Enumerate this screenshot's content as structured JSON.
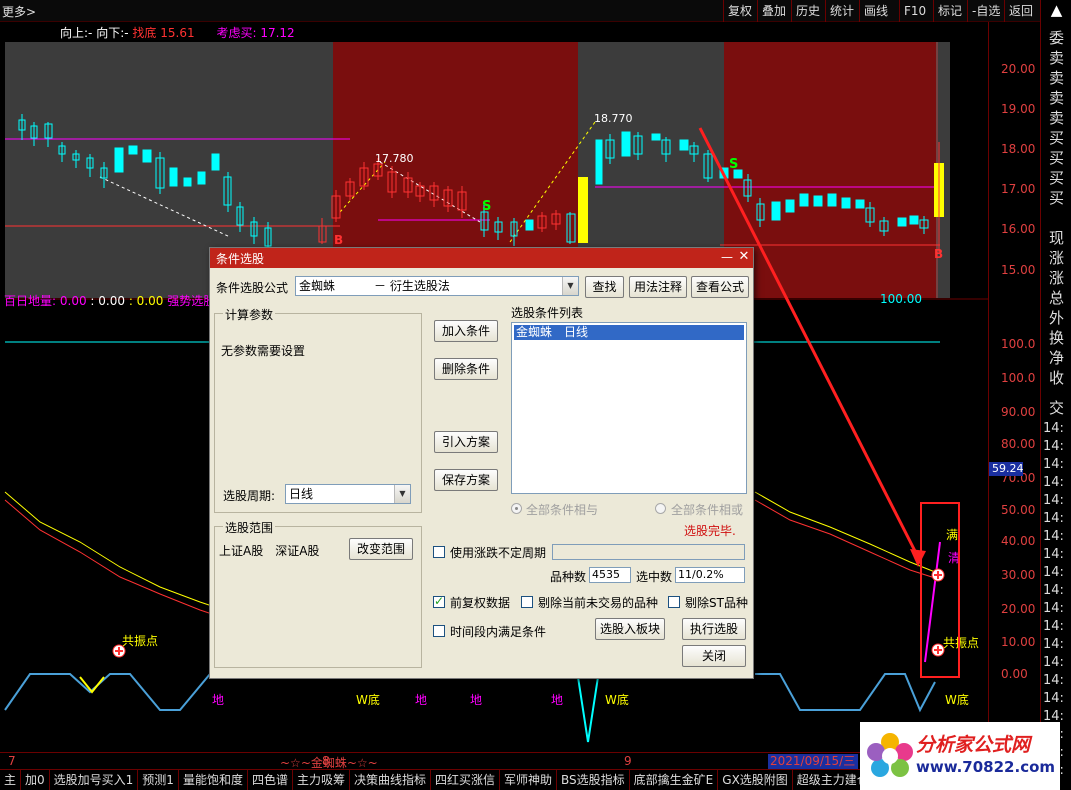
{
  "toolbar": {
    "more": "更多>",
    "buttons": [
      "复权",
      "叠加",
      "历史",
      "统计",
      "画线",
      "F10",
      "标记",
      "-自选",
      "返回"
    ]
  },
  "legend": {
    "up": "向上:-",
    "down": "向下:-",
    "bottom_label": "找底",
    "bottom_value": "15.61",
    "buy_label": "考虑买:",
    "buy_value": "17.12"
  },
  "indicator_legend": {
    "name": "百日地量:",
    "v1": "0.00",
    "v2": ": 0.00",
    "v3": ": 0.00",
    "strong": "强势选股",
    "right_value": "100.00"
  },
  "annotations": {
    "peak1": "17.780",
    "peak2": "18.770",
    "signal_s": "S",
    "signal_b": "B",
    "resonance": "共振点",
    "w_bottom": "W底",
    "ground": "地",
    "full": "满",
    "clear": "清"
  },
  "price_axis": {
    "labels": [
      "20.00",
      "19.00",
      "18.00",
      "17.00",
      "16.00",
      "15.00"
    ],
    "indicator_labels": [
      "100.0",
      "100.0",
      "90.00",
      "80.00",
      "70.00",
      "60.00",
      "50.00",
      "40.00",
      "30.00",
      "20.00",
      "10.00",
      "0.00"
    ],
    "badge": "59.24"
  },
  "right_panel": {
    "items": [
      "委",
      "卖",
      "卖",
      "卖",
      "卖",
      "买",
      "买",
      "买",
      "买",
      "现",
      "涨",
      "涨",
      "总",
      "外",
      "换",
      "净",
      "收",
      "交"
    ],
    "times": [
      "14:",
      "14:",
      "14:",
      "14:",
      "14:",
      "14:",
      "14:",
      "14:",
      "14:",
      "14:",
      "14:",
      "14:",
      "14:",
      "14:",
      "14:",
      "14:",
      "14:",
      "14:",
      "14:",
      "14:"
    ]
  },
  "date_bar": {
    "m7": "7",
    "m8": "8",
    "m9": "9",
    "mantis": "~☆~金蜘蛛~☆~",
    "date": "2021/09/15/三"
  },
  "tabs": [
    "主",
    "加0",
    "选股加号买入1",
    "预测1",
    "量能饱和度",
    "四色谱",
    "主力吸筹",
    "决策曲线指标",
    "四红买涨信",
    "军师神助",
    "BS选股指标",
    "底部擒生金矿E",
    "GX选股附图",
    "超级主力建仓"
  ],
  "logo": {
    "title": "分析家公式网",
    "url": "www.70822.com"
  },
  "dialog": {
    "title": "条件选股",
    "formula_label": "条件选股公式",
    "formula_value": "金蜘蛛",
    "formula_desc": "－ 衍生选股法",
    "btn_find": "查找",
    "btn_usage": "用法注释",
    "btn_formula": "查看公式",
    "params_group": "计算参数",
    "no_params": "无参数需要设置",
    "period_label": "选股周期:",
    "period_value": "日线",
    "btn_add": "加入条件",
    "btn_delete": "删除条件",
    "btn_import": "引入方案",
    "btn_save": "保存方案",
    "list_title": "选股条件列表",
    "list_items": [
      "金蜘蛛　日线"
    ],
    "radio_and": "全部条件相与",
    "radio_or": "全部条件相或",
    "status": "选股完毕.",
    "range_group": "选股范围",
    "range_value": "上证A股　深证A股",
    "btn_range": "改变范围",
    "chk_uncertain": "使用涨跌不定周期",
    "count_label": "品种数",
    "count_value": "4535",
    "selected_label": "选中数",
    "selected_value": "11/0.2%",
    "chk_prior": "前复权数据",
    "chk_exclude_untraded": "剔除当前未交易的品种",
    "chk_exclude_st": "剔除ST品种",
    "chk_period": "时间段内满足条件",
    "btn_to_block": "选股入板块",
    "btn_execute": "执行选股",
    "btn_close": "关闭"
  },
  "colors": {
    "up": "#ff3232",
    "down": "#00ffff",
    "highlight_band": "#7a0e0e",
    "magenta": "#ff00ff",
    "yellow": "#ffff00",
    "accent": "#c0241a"
  }
}
